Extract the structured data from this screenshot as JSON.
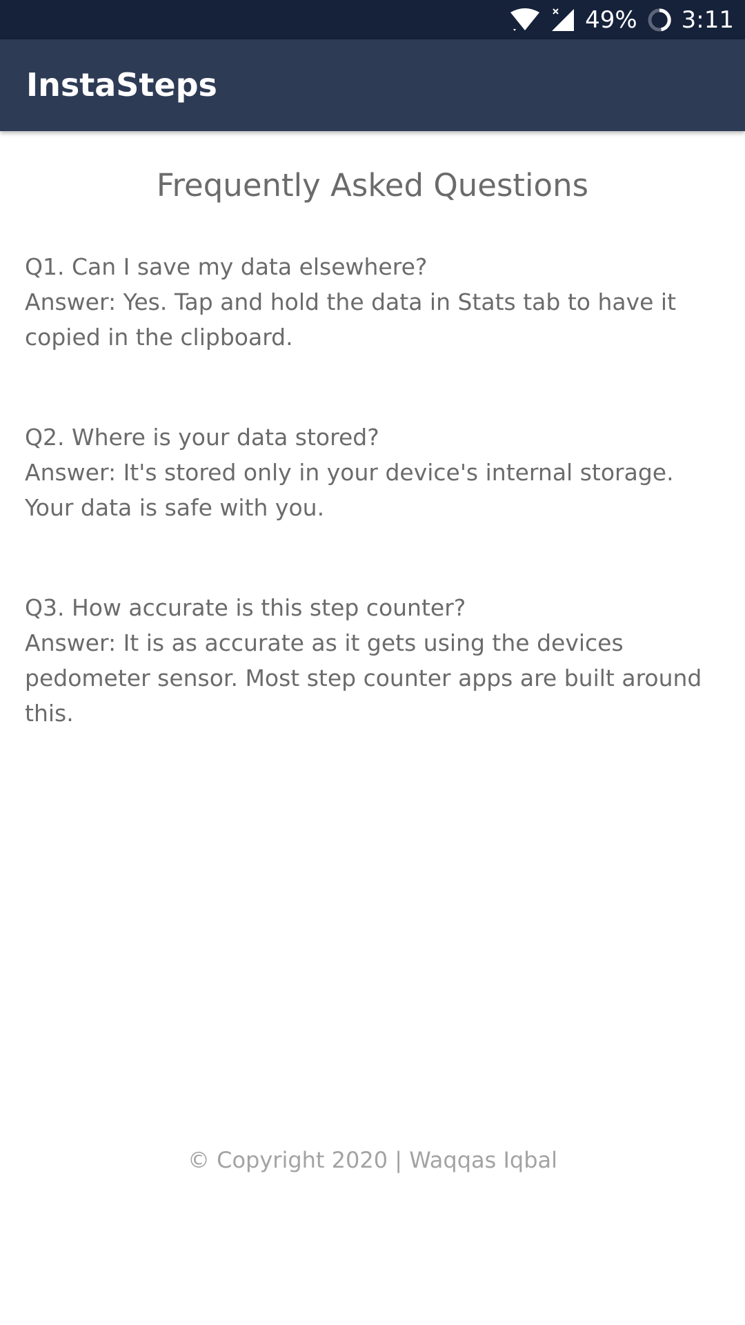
{
  "status_bar": {
    "battery": "49%",
    "time": "3:11",
    "icons": [
      "wifi-icon",
      "signal-no-data-icon",
      "battery-ring-icon"
    ]
  },
  "app_bar": {
    "title": "InstaSteps",
    "background": "#2e3b55"
  },
  "page": {
    "title": "Frequently Asked Questions"
  },
  "faq": [
    {
      "question": "Q1. Can I save my data elsewhere?",
      "answer": "Answer: Yes. Tap and hold the data in Stats tab to have it copied in the clipboard."
    },
    {
      "question": "Q2. Where is your data stored?",
      "answer": "Answer: It's stored only in your device's internal storage. Your data is safe with you."
    },
    {
      "question": "Q3. How accurate is this step counter?",
      "answer": "Answer: It is as accurate as it gets using the devices pedometer sensor. Most step counter apps are built around this."
    }
  ],
  "footer": {
    "copyright": "© Copyright 2020 | Waqqas Iqbal"
  },
  "colors": {
    "status_bar": "#16213a",
    "text": "#6b6b6b",
    "footer_text": "#a3a3a3"
  }
}
